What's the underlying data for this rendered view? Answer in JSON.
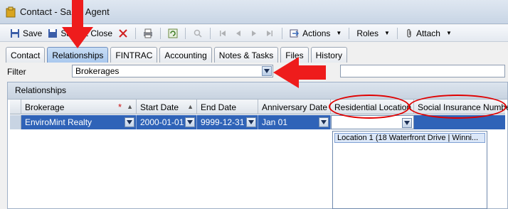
{
  "window": {
    "title": "Contact - Sales Agent"
  },
  "toolbar": {
    "save": "Save",
    "save_close": "Save & Close",
    "actions": "Actions",
    "roles": "Roles",
    "attach": "Attach"
  },
  "tabs": [
    "Contact",
    "Relationships",
    "FINTRAC",
    "Accounting",
    "Notes & Tasks",
    "Files",
    "History"
  ],
  "active_tab": "Relationships",
  "filter": {
    "label": "Filter",
    "value": "Brokerages"
  },
  "panel": {
    "title": "Relationships"
  },
  "grid": {
    "columns": [
      "Brokerage",
      "Start Date",
      "End Date",
      "Anniversary Date",
      "Residential Location",
      "Social Insurance Number"
    ],
    "row": {
      "brokerage": "EnviroMint Realty",
      "start_date": "2000-01-01",
      "end_date": "9999-12-31",
      "anniversary": "Jan 01",
      "residential_location": "",
      "sin": ""
    }
  },
  "dropdown": {
    "items": [
      "Location 1 (18 Waterfront Drive | Winni..."
    ]
  },
  "colors": {
    "annotation": "#e00000",
    "selection": "#2f63b8"
  }
}
